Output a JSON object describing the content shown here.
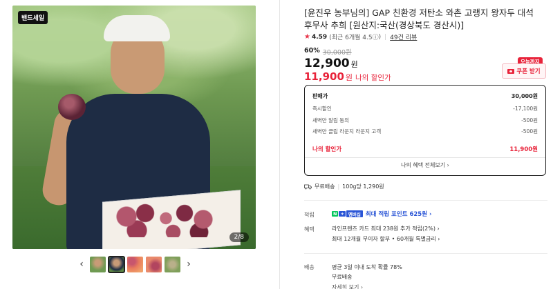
{
  "image": {
    "badge": "밴드세일",
    "counter": "2/8",
    "thumb_prev": "‹",
    "thumb_next": "›",
    "thumb_count": 5,
    "selected_thumb": 2
  },
  "product": {
    "title": "[윤진우 농부님의] GAP 친환경 저탄소 와촌 고랭지 왕자두 대석 후무사 추희 [원산지:국산(경상북도 경산시)]",
    "rating": "4.59",
    "rating_recent": "(최근 6개월 4.5",
    "rating_info_icon": "ⓘ",
    "rating_recent_close": ")",
    "reviews": "49건 리뷰"
  },
  "price": {
    "discount_rate": "60%",
    "original": "30,000원",
    "sale": "12,900",
    "sale_unit": "원",
    "my_price": "11,900",
    "my_price_unit": "원",
    "my_price_label": "나의 할인가",
    "today_tag": "오늘까지",
    "coupon_label": "쿠폰 받기"
  },
  "breakdown": {
    "head_label": "판매가",
    "head_value": "30,000원",
    "rows": [
      {
        "label": "즉시할인",
        "value": "-17,100원"
      },
      {
        "label": "새벽만 알림 동의",
        "value": "-500원"
      },
      {
        "label": "새벽만 클립 라운지 라운지 고객",
        "value": "-500원"
      }
    ],
    "final_label": "나의 할인가",
    "final_value": "11,900원",
    "more_label": "나의 혜택 전체보기 ›"
  },
  "shipping": {
    "label": "무료배송",
    "unit_price": "100g당 1,290원"
  },
  "benefits": {
    "points_label": "적립",
    "np_n": "N",
    "np_plus": "+",
    "np_membership": "멤버십",
    "points_text": "최대 적립 포인트 625원 ›",
    "benefit_label": "혜택",
    "card_text": "라인프렌즈 카드 최대 238원 추가 적립(2%) ›",
    "installment_text": "최대 12개월 무이자 할부 • 60개월 특별금리 ›"
  },
  "delivery": {
    "label": "배송",
    "arrival": "평균 3일 이내 도착 확률 78%",
    "free": "무료배송",
    "more": "자세히 보기 ›"
  },
  "colors": {
    "accent_red": "#e8233a",
    "points_blue": "#2a55d6",
    "naver_green": "#03c75a"
  }
}
